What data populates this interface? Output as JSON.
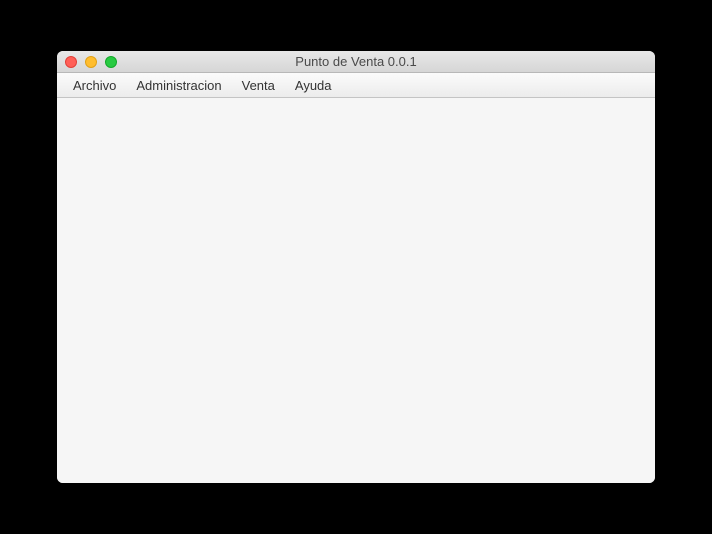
{
  "window": {
    "title": "Punto de Venta 0.0.1"
  },
  "menubar": {
    "items": [
      {
        "label": "Archivo"
      },
      {
        "label": "Administracion"
      },
      {
        "label": "Venta"
      },
      {
        "label": "Ayuda"
      }
    ]
  }
}
